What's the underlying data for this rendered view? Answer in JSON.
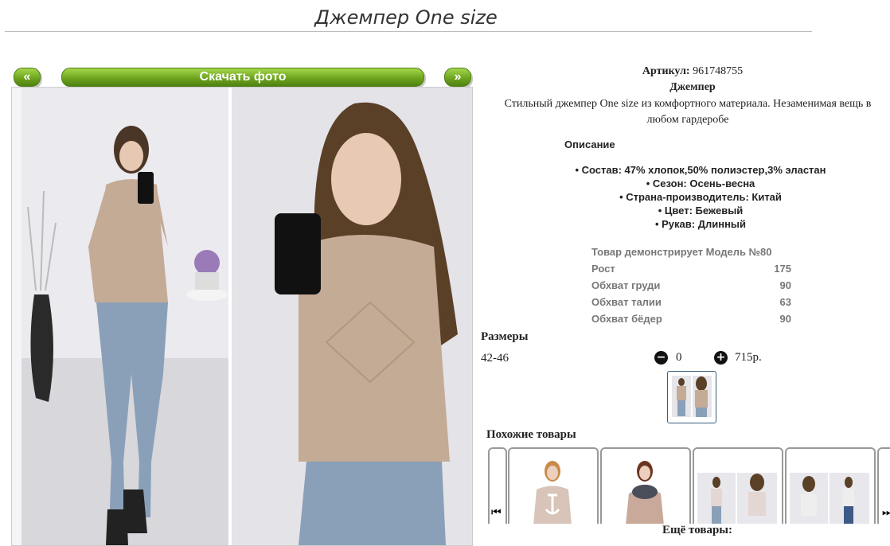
{
  "page": {
    "title": "Джемпер One size"
  },
  "gallery": {
    "prev_label": "«",
    "download_label": "Скачать фото",
    "next_label": "»"
  },
  "product": {
    "article_label": "Артикул:",
    "article_value": "961748755",
    "name": "Джемпер",
    "description_line1": "Стильный джемпер One size из комфортного материала. Незаменимая вещь в",
    "description_line2": "любом гардеробе"
  },
  "description": {
    "heading": "Описание",
    "features": [
      "• Состав: 47% хлопок,50% полиэстер,3% эластан",
      "• Сезон: Осень-весна",
      "• Страна-производитель: Китай",
      "• Цвет: Бежевый",
      "• Рукав: Длинный"
    ]
  },
  "model": {
    "rows": [
      {
        "label": "Товар демонстрирует Модель №80",
        "value": ""
      },
      {
        "label": "Рост",
        "value": "175"
      },
      {
        "label": "Обхват груди",
        "value": "90"
      },
      {
        "label": "Обхват талии",
        "value": "63"
      },
      {
        "label": "Обхват бёдер",
        "value": "90"
      }
    ]
  },
  "sizes": {
    "heading": "Размеры",
    "size": "42-46",
    "minus_icon": "minus-circle-icon",
    "plus_icon": "plus-circle-icon",
    "quantity": "0",
    "price": "715р."
  },
  "similar": {
    "heading": "Похожие товары",
    "prev_icon": "skip-back-icon",
    "next_icon": "skip-forward-icon"
  },
  "more": {
    "label": "Ещё товары:"
  },
  "colors": {
    "button_green": "#6ea51e",
    "sweater_beige": "#c4ab96",
    "jeans_blue": "#8aa0b8"
  }
}
